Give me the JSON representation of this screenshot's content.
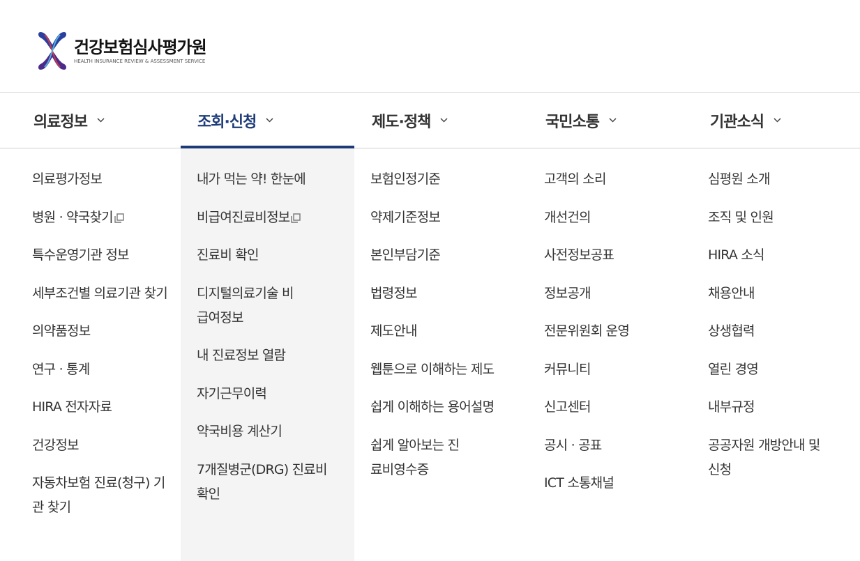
{
  "header": {
    "logo_ko": "건강보험심사평가원",
    "logo_en": "HEALTH INSURANCE REVIEW & ASSESSMENT SERVICE"
  },
  "nav": {
    "items": [
      {
        "label": "의료정보"
      },
      {
        "label": "조회·신청"
      },
      {
        "label": "제도·정책"
      },
      {
        "label": "국민소통"
      },
      {
        "label": "기관소식"
      }
    ],
    "active_index": 1
  },
  "menu": {
    "col1": [
      {
        "label": "의료평가정보"
      },
      {
        "label": "병원 · 약국찾기"
      },
      {
        "label": "특수운영기관 정보"
      },
      {
        "label": "세부조건별 의료기관 찾기"
      },
      {
        "label": "의약품정보"
      },
      {
        "label": "연구 · 통계"
      },
      {
        "label": "HIRA 전자자료"
      },
      {
        "label": "건강정보"
      },
      {
        "label": "자동차보험 진료(청구) 기관 찾기"
      }
    ],
    "col2": [
      {
        "label": "내가 먹는 약! 한눈에"
      },
      {
        "label": "비급여진료비정보"
      },
      {
        "label": "진료비 확인"
      },
      {
        "label": "디지털의료기술 비급여정보"
      },
      {
        "label": "내 진료정보 열람"
      },
      {
        "label": "자기근무이력"
      },
      {
        "label": "약국비용 계산기"
      },
      {
        "label": "7개질병군(DRG) 진료비 확인"
      }
    ],
    "col3": [
      {
        "label": "보험인정기준"
      },
      {
        "label": "약제기준정보"
      },
      {
        "label": "본인부담기준"
      },
      {
        "label": "법령정보"
      },
      {
        "label": "제도안내"
      },
      {
        "label": "웹툰으로 이해하는 제도"
      },
      {
        "label": "쉽게 이해하는 용어설명"
      },
      {
        "label": "쉽게 알아보는 진료비영수증"
      }
    ],
    "col4": [
      {
        "label": "고객의 소리"
      },
      {
        "label": "개선건의"
      },
      {
        "label": "사전정보공표"
      },
      {
        "label": "정보공개"
      },
      {
        "label": "전문위원회 운영"
      },
      {
        "label": "커뮤니티"
      },
      {
        "label": "신고센터"
      },
      {
        "label": "공시 · 공표"
      },
      {
        "label": "ICT 소통채널"
      }
    ],
    "col5": [
      {
        "label": "심평원 소개"
      },
      {
        "label": "조직 및 인원"
      },
      {
        "label": "HIRA 소식"
      },
      {
        "label": "채용안내"
      },
      {
        "label": "상생협력"
      },
      {
        "label": "열린 경영"
      },
      {
        "label": "내부규정"
      },
      {
        "label": "공공자원 개방안내 및 신청"
      }
    ]
  },
  "icons": {
    "external": "new-window-icon",
    "chevron": "chevron-down-icon"
  },
  "colors": {
    "active_nav": "#1f3c7a",
    "active_bar": "#1d3a78",
    "active_column_bg": "#f4f4f4",
    "logo_blue": "#2b3f9e",
    "logo_red": "#b3263a"
  }
}
